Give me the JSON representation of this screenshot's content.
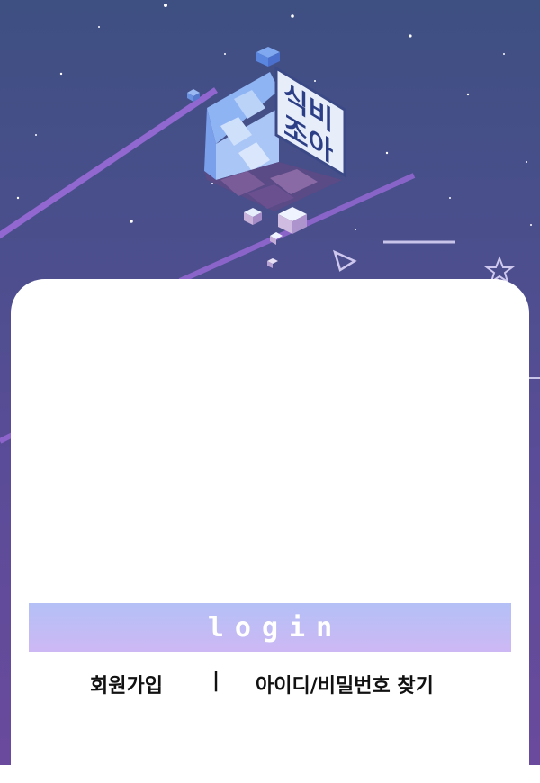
{
  "brand": {
    "logo_text_line1": "식비",
    "logo_text_line2": "조아"
  },
  "login": {
    "button_label": "login"
  },
  "links": {
    "signup_label": "회원가입",
    "separator": "|",
    "find_account_label": "아이디/비밀번호 찾기"
  },
  "colors": {
    "background_top": "#3e4f82",
    "background_bottom": "#6a4a9c",
    "card": "#ffffff",
    "button_gradient_top": "#b4c0f6",
    "button_gradient_bottom": "#cdb8f4",
    "text": "#111111"
  }
}
